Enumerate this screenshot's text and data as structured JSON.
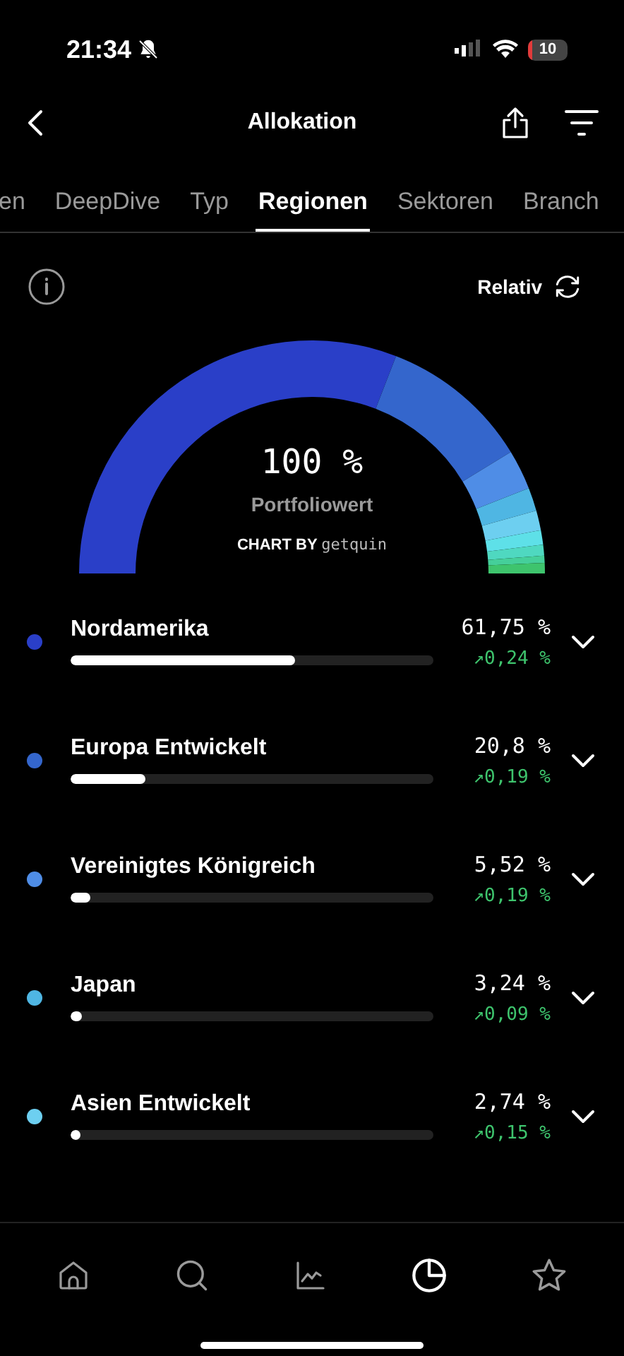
{
  "status_bar": {
    "time": "21:34",
    "battery": "10"
  },
  "header": {
    "title": "Allokation"
  },
  "tabs": [
    {
      "label": "en",
      "selected": false
    },
    {
      "label": "DeepDive",
      "selected": false
    },
    {
      "label": "Typ",
      "selected": false
    },
    {
      "label": "Regionen",
      "selected": true
    },
    {
      "label": "Sektoren",
      "selected": false
    },
    {
      "label": "Branch",
      "selected": false
    }
  ],
  "mode": {
    "label": "Relativ"
  },
  "gauge": {
    "value": "100",
    "unit": "%",
    "caption": "Portfoliowert",
    "credit_label": "CHART BY",
    "credit_brand": "getquin"
  },
  "regions": [
    {
      "name": "Nordamerika",
      "color": "#2a3fc8",
      "level": 0.6175,
      "share": "61,75 %",
      "change": "↗0,24 %",
      "expanded": false
    },
    {
      "name": "Europa Entwickelt",
      "color": "#3466cc",
      "level": 0.208,
      "share": "20,8 %",
      "change": "↗0,19 %",
      "expanded": false
    },
    {
      "name": "Vereinigtes Königreich",
      "color": "#4f8de6",
      "level": 0.0552,
      "share": "5,52 %",
      "change": "↗0,19 %",
      "expanded": false
    },
    {
      "name": "Japan",
      "color": "#4fb6e3",
      "level": 0.0324,
      "share": "3,24 %",
      "change": "↗0,09 %",
      "expanded": false
    },
    {
      "name": "Asien Entwickelt",
      "color": "#6dcff0",
      "level": 0.0274,
      "share": "2,74 %",
      "change": "↗0,15 %",
      "expanded": false
    }
  ],
  "nav": [
    {
      "kind": "home",
      "selected": false
    },
    {
      "kind": "search",
      "selected": false
    },
    {
      "kind": "chart",
      "selected": false
    },
    {
      "kind": "pie",
      "selected": true
    },
    {
      "kind": "star",
      "selected": false
    }
  ]
}
